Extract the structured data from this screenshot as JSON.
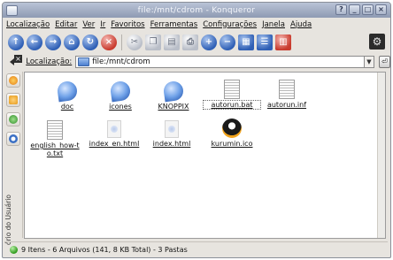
{
  "window": {
    "title": "file:/mnt/cdrom - Konqueror",
    "buttons": [
      "?",
      "_",
      "□",
      "×"
    ]
  },
  "menubar": {
    "items": [
      "Localização",
      "Editar",
      "Ver",
      "Ir",
      "Favoritos",
      "Ferramentas",
      "Configurações",
      "Janela",
      "Ajuda"
    ]
  },
  "toolbar": {
    "icons": [
      "up-arrow-icon",
      "back-arrow-icon",
      "forward-arrow-icon",
      "home-icon",
      "reload-icon",
      "stop-icon",
      "cut-icon",
      "copy-icon",
      "paste-icon",
      "print-icon",
      "zoom-in-icon",
      "zoom-out-icon",
      "view-icon-view",
      "view-list-view",
      "view-detail-view",
      "gear-icon"
    ]
  },
  "location": {
    "label": "Localização:",
    "value": "file:/mnt/cdrom",
    "go_label": "⏎"
  },
  "sidepanel": {
    "vertical_label": "ório do Usuário"
  },
  "files": [
    {
      "name": "doc",
      "type": "folder"
    },
    {
      "name": "icones",
      "type": "folder"
    },
    {
      "name": "KNOPPIX",
      "type": "folder"
    },
    {
      "name": "autorun.bat",
      "type": "doc"
    },
    {
      "name": "autorun.inf",
      "type": "doc"
    },
    {
      "name": "english_how-to.txt",
      "type": "doc"
    },
    {
      "name": "index_en.html",
      "type": "html"
    },
    {
      "name": "index.html",
      "type": "html"
    },
    {
      "name": "kurumin.ico",
      "type": "tux"
    }
  ],
  "status": {
    "text": "9 Itens - 6 Arquivos (141, 8 KB Total) - 3 Pastas"
  },
  "colors": {
    "titlebar": "#8e9ab3",
    "folder_blue": "#4b7fd0",
    "status_green": "#2e9a1b"
  }
}
